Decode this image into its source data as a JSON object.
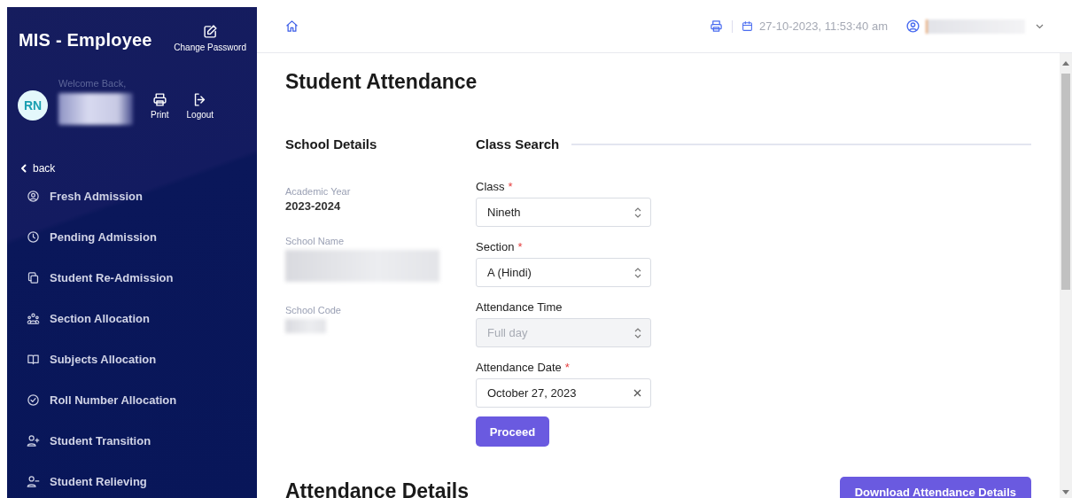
{
  "app_title": "MIS - Employee",
  "change_password": "Change Password",
  "user": {
    "avatar_initials": "RN",
    "greeting": "Welcome Back,",
    "name_redacted": true
  },
  "header_actions": [
    {
      "kind": "print",
      "label": "Print"
    },
    {
      "kind": "logout",
      "label": "Logout"
    }
  ],
  "back_label": "back",
  "sidebar_items": [
    {
      "kind": "user",
      "label": "Fresh Admission"
    },
    {
      "kind": "clock",
      "label": "Pending Admission"
    },
    {
      "kind": "copy",
      "label": "Student Re-Admission"
    },
    {
      "kind": "group",
      "label": "Section Allocation"
    },
    {
      "kind": "book",
      "label": "Subjects Allocation"
    },
    {
      "kind": "check",
      "label": "Roll Number Allocation"
    },
    {
      "kind": "user-plus",
      "label": "Student Transition"
    },
    {
      "kind": "user-minus",
      "label": "Student Relieving"
    }
  ],
  "topbar": {
    "datetime": "27-10-2023, 11:53:40 am",
    "user_redacted": true
  },
  "page_title": "Student Attendance",
  "school_details": {
    "title": "School Details",
    "fields": [
      {
        "label": "Academic Year",
        "value": "2023-2024"
      },
      {
        "label": "School Name",
        "redacted": true
      },
      {
        "label": "School Code",
        "redacted": true
      }
    ]
  },
  "class_search": {
    "title": "Class Search",
    "fields": [
      {
        "kind": "select",
        "label": "Class",
        "required_mark": "*",
        "value": "Nineth",
        "disabled": false
      },
      {
        "kind": "select",
        "label": "Section",
        "required_mark": "*",
        "value": "A (Hindi)",
        "disabled": false
      },
      {
        "kind": "select",
        "label": "Attendance Time",
        "value": "Full day",
        "disabled": true
      },
      {
        "kind": "date",
        "label": "Attendance Date",
        "required_mark": "*",
        "value": "October 27, 2023",
        "disabled": false
      }
    ],
    "submit": "Proceed"
  },
  "attendance_details": {
    "title": "Attendance Details",
    "download": "Download Attendance Details"
  }
}
